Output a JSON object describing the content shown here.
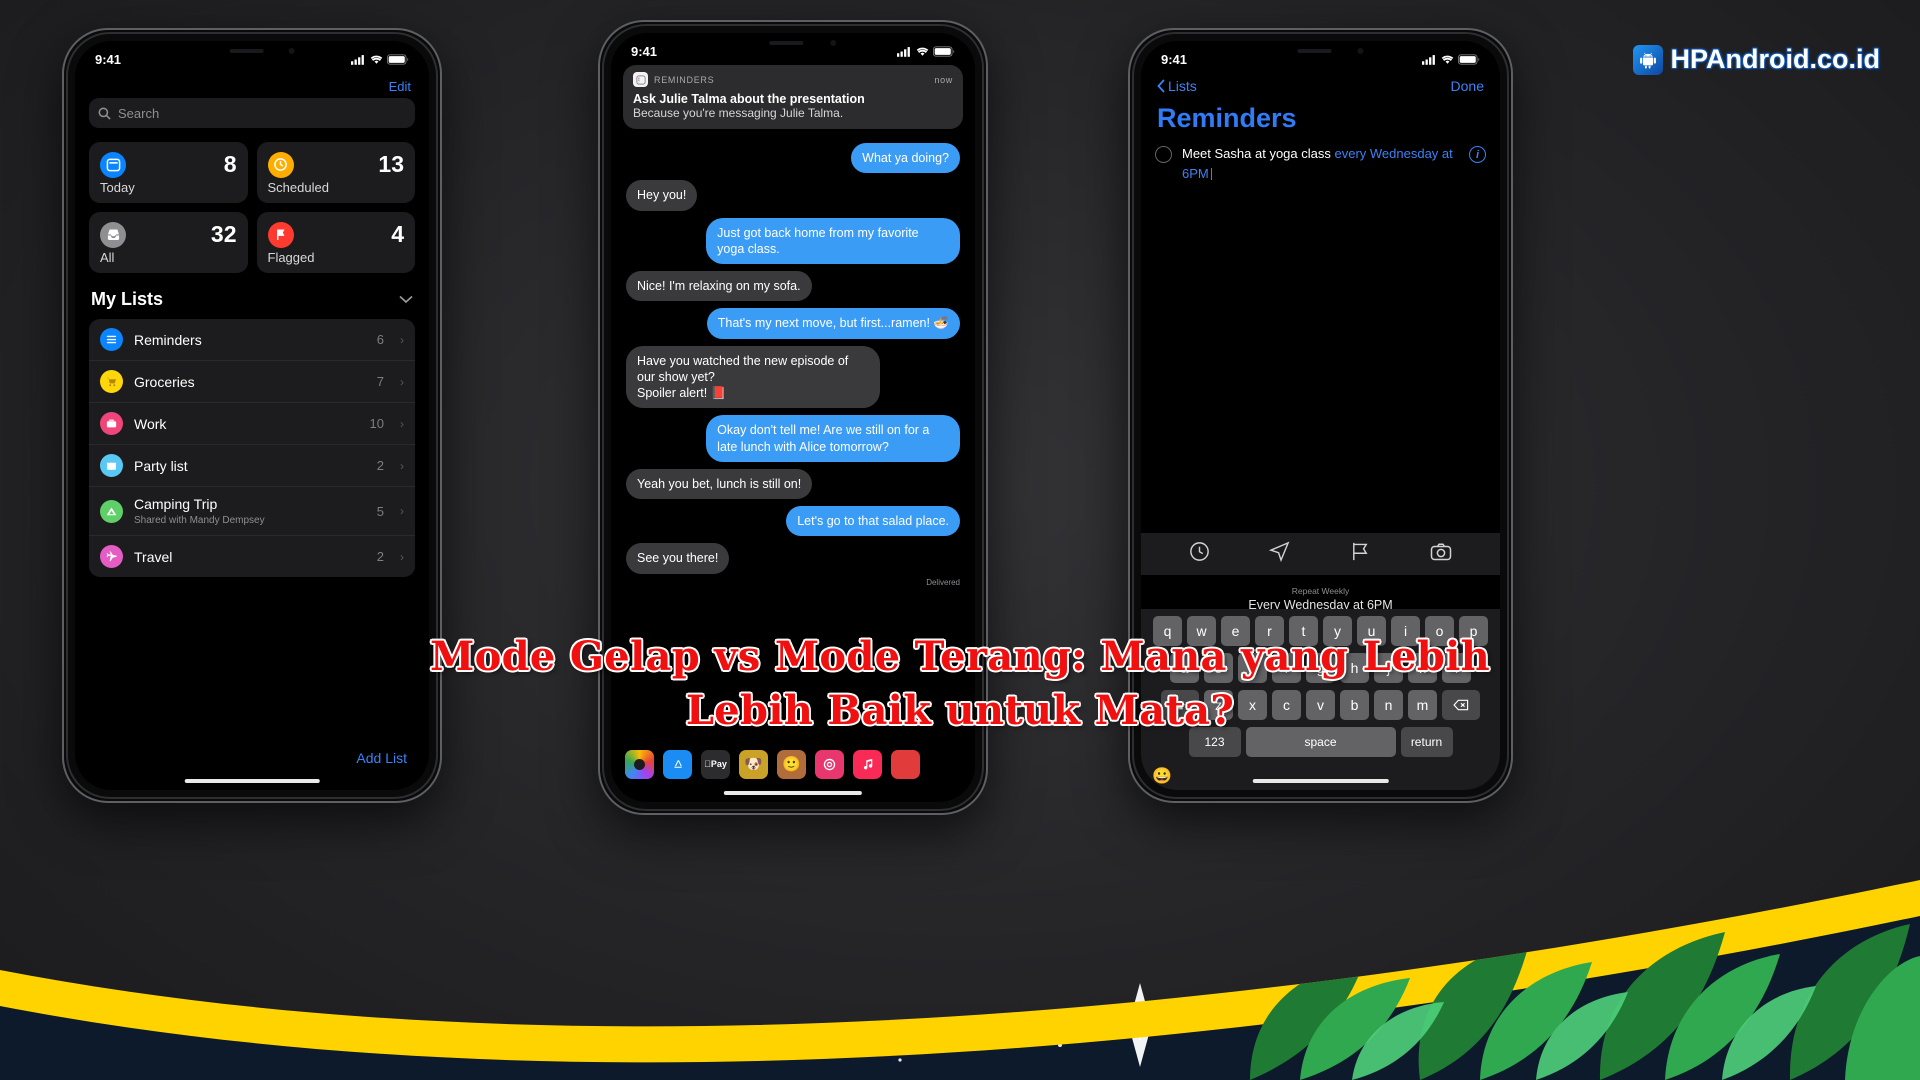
{
  "watermark": {
    "text": "HPAndroid.co.id",
    "icon": "android-robot-icon"
  },
  "headline": {
    "line1": "Mode Gelap vs Mode Terang: Mana yang Lebih",
    "line2": "Lebih Baik untuk Mata?",
    "color": "#f01010"
  },
  "phone1": {
    "status": {
      "time": "9:41",
      "cellular": "cellular-icon",
      "wifi": "wifi-icon",
      "battery": "battery-icon"
    },
    "edit_label": "Edit",
    "search": {
      "placeholder": "Search",
      "icon": "search-icon"
    },
    "tiles": [
      {
        "label": "Today",
        "count": "8",
        "icon": "calendar-icon",
        "color": "#0a84ff"
      },
      {
        "label": "Scheduled",
        "count": "13",
        "icon": "clock-icon",
        "color": "#ffae00"
      },
      {
        "label": "All",
        "count": "32",
        "icon": "tray-icon",
        "color": "#8e8e93"
      },
      {
        "label": "Flagged",
        "count": "4",
        "icon": "flag-icon",
        "color": "#ff3b30"
      }
    ],
    "my_lists_header": "My Lists",
    "collapse_icon": "chevron-down-icon",
    "lists": [
      {
        "name": "Reminders",
        "count": "6",
        "icon": "list-icon",
        "color": "#0a84ff",
        "sub": ""
      },
      {
        "name": "Groceries",
        "count": "7",
        "icon": "cart-icon",
        "color": "#ffd60a",
        "sub": ""
      },
      {
        "name": "Work",
        "count": "10",
        "icon": "briefcase-icon",
        "color": "#f0457a",
        "sub": ""
      },
      {
        "name": "Party list",
        "count": "2",
        "icon": "gift-icon",
        "color": "#5ac8f5",
        "sub": ""
      },
      {
        "name": "Camping Trip",
        "count": "5",
        "icon": "tent-icon",
        "color": "#5fd068",
        "sub": "Shared with Mandy Dempsey"
      },
      {
        "name": "Travel",
        "count": "2",
        "icon": "airplane-icon",
        "color": "#e45cc4",
        "sub": ""
      }
    ],
    "add_list_label": "Add List"
  },
  "phone2": {
    "status": {
      "time": "9:41"
    },
    "notification": {
      "app": "REMINDERS",
      "time": "now",
      "title": "Ask Julie Talma about the presentation",
      "subtitle": "Because you're messaging Julie Talma.",
      "icon": "reminders-app-icon"
    },
    "messages": [
      {
        "side": "out",
        "text": "What ya doing?"
      },
      {
        "side": "in",
        "text": "Hey you!"
      },
      {
        "side": "out",
        "text": "Just got back home from my favorite yoga class."
      },
      {
        "side": "in",
        "text": "Nice! I'm relaxing on my sofa."
      },
      {
        "side": "out",
        "text": "That's my next move, but first...ramen! 🍜"
      },
      {
        "side": "in",
        "text": "Have you watched the new episode of our show yet?\nSpoiler alert! 📕"
      },
      {
        "side": "out",
        "text": "Okay don't tell me! Are we still on for a late lunch with Alice tomorrow?"
      },
      {
        "side": "in",
        "text": "Yeah you bet, lunch is still on!"
      },
      {
        "side": "out",
        "text": "Let's go to that salad place."
      },
      {
        "side": "in",
        "text": "See you there!"
      }
    ],
    "delivered_label": "Delivered",
    "app_drawer": [
      {
        "name": "photos-icon",
        "color": "#ffffff"
      },
      {
        "name": "app-store-icon",
        "color": "#1b8cf3"
      },
      {
        "name": "apple-pay-icon",
        "color": "#2c2c2e"
      },
      {
        "name": "memoji-dog-icon",
        "color": "#c9a227"
      },
      {
        "name": "memoji-face-icon",
        "color": "#b06c3a"
      },
      {
        "name": "digital-touch-icon",
        "color": "#e8376f"
      },
      {
        "name": "music-icon",
        "color": "#fa2a56"
      },
      {
        "name": "more-apps-icon",
        "color": "#e23b3b"
      }
    ]
  },
  "phone3": {
    "status": {
      "time": "9:41"
    },
    "back_label": "Lists",
    "done_label": "Done",
    "title": "Reminders",
    "task": {
      "text_plain": "Meet Sasha at yoga class ",
      "text_highlight": "every Wednesday at 6PM",
      "info_icon": "info-icon"
    },
    "toolbar": [
      {
        "name": "clock-icon"
      },
      {
        "name": "location-icon"
      },
      {
        "name": "flag-icon"
      },
      {
        "name": "camera-icon"
      }
    ],
    "repeat": {
      "label": "Repeat Weekly",
      "value": "Every Wednesday at 6PM"
    },
    "keyboard": {
      "row1": [
        "q",
        "w",
        "e",
        "r",
        "t",
        "y",
        "u",
        "i",
        "o",
        "p"
      ],
      "row2": [
        "a",
        "s",
        "d",
        "f",
        "g",
        "h",
        "j",
        "k",
        "l"
      ],
      "row3": [
        "z",
        "x",
        "c",
        "v",
        "b",
        "n",
        "m"
      ],
      "shift": "shift-key-icon",
      "backspace": "backspace-key-icon",
      "numbers_label": "123",
      "space_label": "space",
      "return_label": "return",
      "emoji": "emoji-key-icon"
    }
  }
}
